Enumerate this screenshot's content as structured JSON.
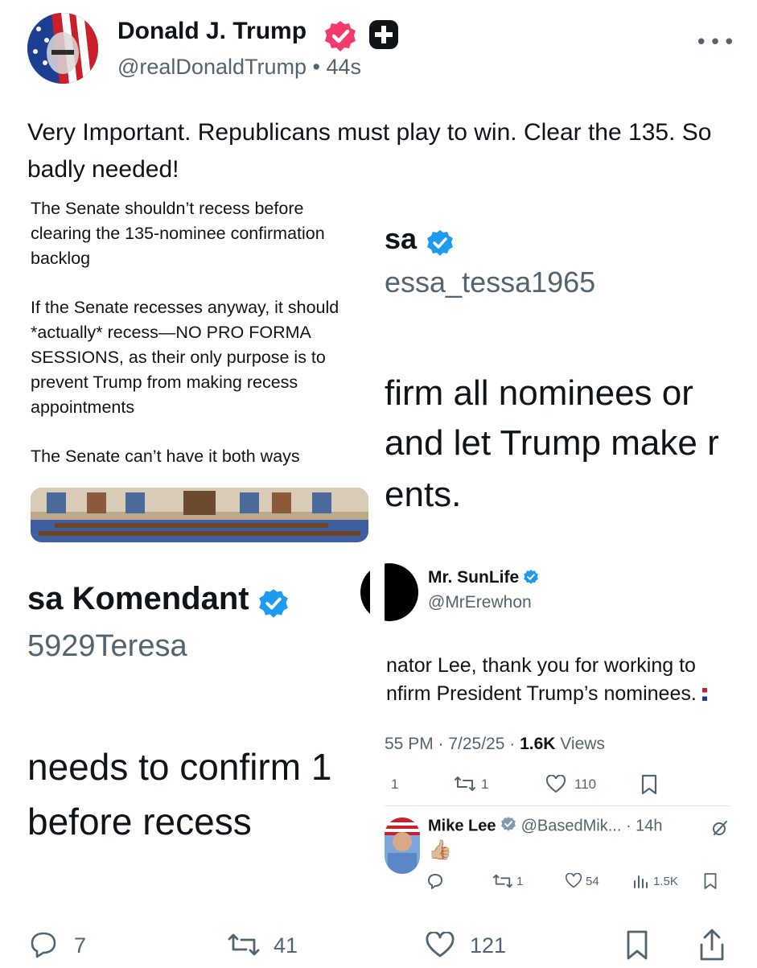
{
  "author": {
    "name": "Donald J. Trump",
    "handle": "@realDonaldTrump",
    "separator": "•",
    "time": "44s"
  },
  "post": {
    "text": "Very Important. Republicans must play to win. Clear the 135. So badly needed!"
  },
  "collage": {
    "text_block": {
      "para1": "The Senate shouldn’t recess before clearing the 135-nominee confirmation backlog",
      "para2": "If the Senate recesses anyway, it should *actually* recess—NO PRO FORMA SESSIONS, as their only purpose is to prevent Trump from making recess appointments",
      "para3": "The Senate can’t have it both ways"
    },
    "top_right": {
      "name_fragment": "sa",
      "handle_fragment": "essa_tessa1965",
      "line1": "firm all nominees or",
      "line2": "and let Trump make r",
      "line3": "ents."
    },
    "bottom_left": {
      "name_fragment": "sa Komendant",
      "handle_fragment": "5929Teresa",
      "line1": "needs to confirm 1",
      "line2": "before recess"
    },
    "sunlife": {
      "name": "Mr. SunLife",
      "handle": "@MrErewhon",
      "line1": "nator Lee, thank you for working to",
      "line2": "nfirm President Trump’s nominees.",
      "time_date": "55 PM · 7/25/25 · ",
      "views_count": "1.6K",
      "views_label": " Views",
      "replies": "1",
      "reposts": "1",
      "likes": "110"
    },
    "mikelee": {
      "name": "Mike Lee",
      "handle_time": "@BasedMik... · 14h",
      "emoji": "👍🏼",
      "reposts": "1",
      "likes": "54",
      "views": "1.5K"
    }
  },
  "actions": {
    "replies": "7",
    "reposts": "41",
    "likes": "121"
  },
  "colors": {
    "verified_pink": "#f4396b",
    "verified_blue": "#1d9bf0",
    "text": "#0f1419",
    "muted": "#536471"
  }
}
